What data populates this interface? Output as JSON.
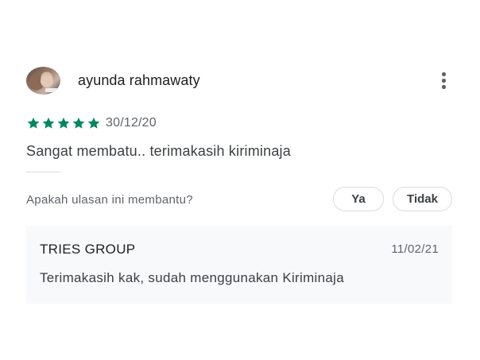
{
  "review": {
    "author_name": "ayunda rahmawaty",
    "rating": 5,
    "max_rating": 5,
    "date": "30/12/20",
    "text": "Sangat membatu.. terimakasih kiriminaja",
    "star_color": "#01875f",
    "more_icon": "more-vert-icon"
  },
  "helpful": {
    "question": "Apakah ulasan ini membantu?",
    "yes_label": "Ya",
    "no_label": "Tidak"
  },
  "reply": {
    "developer": "TRIES GROUP",
    "date": "11/02/21",
    "text": "Terimakasih kak, sudah menggunakan Kiriminaja"
  }
}
